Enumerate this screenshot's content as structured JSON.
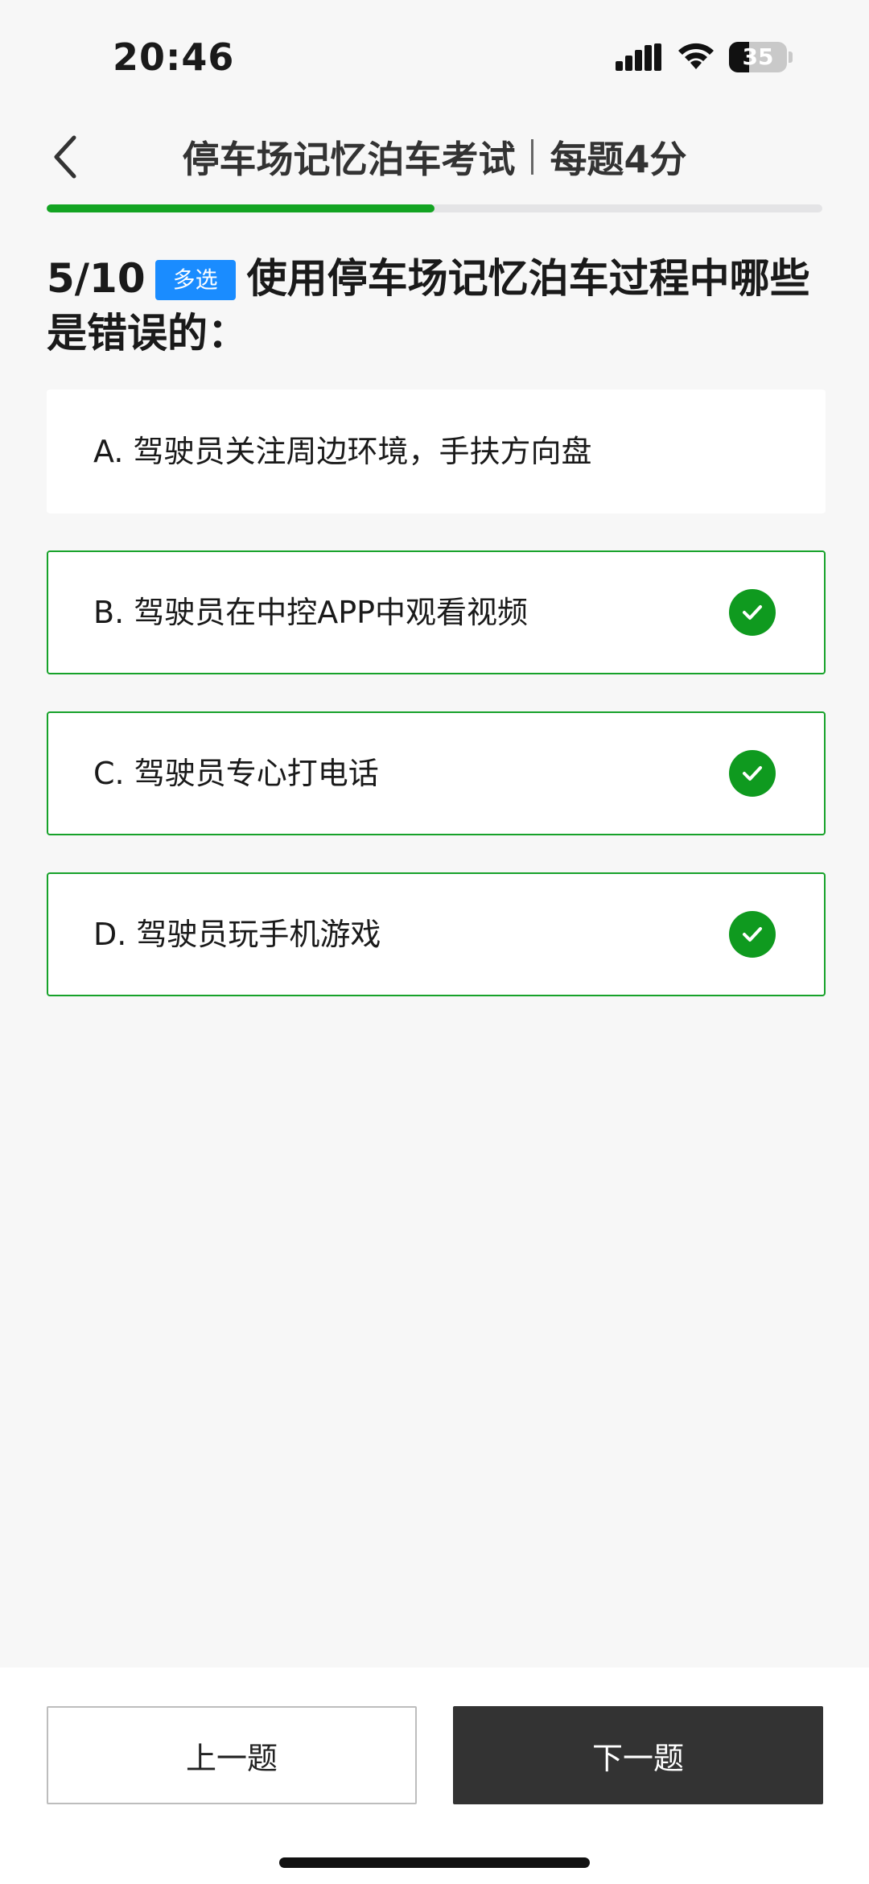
{
  "status_bar": {
    "time": "20:46",
    "battery_level": "35",
    "battery_fraction": 0.35,
    "icons": [
      "signal-icon",
      "wifi-icon",
      "battery-icon"
    ]
  },
  "header": {
    "title": "停车场记忆泊车考试",
    "score_note": "每题4分",
    "back_icon": "chevron-left-icon"
  },
  "progress": {
    "current": 5,
    "total": 10,
    "fraction": 0.5,
    "color": "#13a422"
  },
  "question": {
    "number": "5/10",
    "type_tag": "多选",
    "text": "使用停车场记忆泊车过程中哪些是错误的："
  },
  "options": [
    {
      "label": "A. 驾驶员关注周边环境，手扶方向盘",
      "selected": false
    },
    {
      "label": "B. 驾驶员在中控APP中观看视频",
      "selected": true
    },
    {
      "label": "C. 驾驶员专心打电话",
      "selected": true
    },
    {
      "label": "D. 驾驶员玩手机游戏",
      "selected": true
    }
  ],
  "footer": {
    "prev_label": "上一题",
    "next_label": "下一题"
  },
  "colors": {
    "accent_green": "#17a22a",
    "tag_blue": "#1a8cff",
    "next_button": "#333333",
    "background": "#f7f7f7"
  }
}
